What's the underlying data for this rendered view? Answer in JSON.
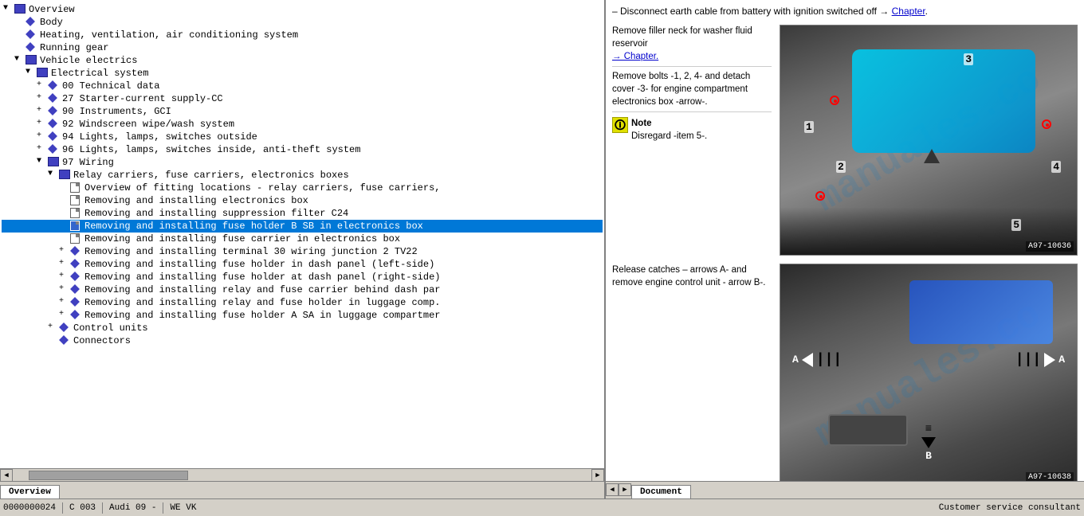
{
  "left_panel": {
    "tree_items": [
      {
        "id": 1,
        "indent": 0,
        "expand": "▼",
        "icon": "book",
        "label": "Overview",
        "selected": false
      },
      {
        "id": 2,
        "indent": 1,
        "expand": "",
        "icon": "diamond",
        "label": "Body",
        "selected": false
      },
      {
        "id": 3,
        "indent": 1,
        "expand": "",
        "icon": "diamond",
        "label": "Heating, ventilation, air conditioning system",
        "selected": false
      },
      {
        "id": 4,
        "indent": 1,
        "expand": "",
        "icon": "diamond",
        "label": "Running gear",
        "selected": false
      },
      {
        "id": 5,
        "indent": 1,
        "expand": "▼",
        "icon": "book",
        "label": "Vehicle electrics",
        "selected": false
      },
      {
        "id": 6,
        "indent": 2,
        "expand": "▼",
        "icon": "book",
        "label": "Electrical system",
        "selected": false
      },
      {
        "id": 7,
        "indent": 3,
        "expand": "+",
        "icon": "diamond",
        "label": "00 Technical data",
        "selected": false
      },
      {
        "id": 8,
        "indent": 3,
        "expand": "+",
        "icon": "diamond",
        "label": "27 Starter-current supply-CC",
        "selected": false
      },
      {
        "id": 9,
        "indent": 3,
        "expand": "+",
        "icon": "diamond",
        "label": "90 Instruments, GCI",
        "selected": false
      },
      {
        "id": 10,
        "indent": 3,
        "expand": "+",
        "icon": "diamond",
        "label": "92 Windscreen wipe/wash system",
        "selected": false
      },
      {
        "id": 11,
        "indent": 3,
        "expand": "+",
        "icon": "diamond",
        "label": "94 Lights, lamps, switches outside",
        "selected": false
      },
      {
        "id": 12,
        "indent": 3,
        "expand": "+",
        "icon": "diamond",
        "label": "96 Lights, lamps, switches inside, anti-theft system",
        "selected": false
      },
      {
        "id": 13,
        "indent": 3,
        "expand": "▼",
        "icon": "book",
        "label": "97 Wiring",
        "selected": false
      },
      {
        "id": 14,
        "indent": 4,
        "expand": "▼",
        "icon": "book",
        "label": "Relay carriers, fuse carriers, electronics boxes",
        "selected": false
      },
      {
        "id": 15,
        "indent": 5,
        "expand": "",
        "icon": "doc",
        "label": "Overview of fitting locations - relay carriers, fuse carriers,",
        "selected": false
      },
      {
        "id": 16,
        "indent": 5,
        "expand": "",
        "icon": "doc",
        "label": "Removing and installing electronics box",
        "selected": false
      },
      {
        "id": 17,
        "indent": 5,
        "expand": "",
        "icon": "doc",
        "label": "Removing and installing suppression filter C24",
        "selected": false
      },
      {
        "id": 18,
        "indent": 5,
        "expand": "",
        "icon": "doc",
        "label": "Removing and installing fuse holder B SB in electronics box",
        "selected": true
      },
      {
        "id": 19,
        "indent": 5,
        "expand": "",
        "icon": "doc",
        "label": "Removing and installing fuse carrier in electronics box",
        "selected": false
      },
      {
        "id": 20,
        "indent": 5,
        "expand": "+",
        "icon": "diamond",
        "label": "Removing and installing terminal 30 wiring junction 2 TV22",
        "selected": false
      },
      {
        "id": 21,
        "indent": 5,
        "expand": "+",
        "icon": "diamond",
        "label": "Removing and installing fuse holder in dash panel (left-side)",
        "selected": false
      },
      {
        "id": 22,
        "indent": 5,
        "expand": "+",
        "icon": "diamond",
        "label": "Removing and installing fuse holder at dash panel (right-side)",
        "selected": false
      },
      {
        "id": 23,
        "indent": 5,
        "expand": "+",
        "icon": "diamond",
        "label": "Removing and installing relay and fuse carrier behind dash par",
        "selected": false
      },
      {
        "id": 24,
        "indent": 5,
        "expand": "+",
        "icon": "diamond",
        "label": "Removing and installing relay and fuse holder in luggage comp.",
        "selected": false
      },
      {
        "id": 25,
        "indent": 5,
        "expand": "+",
        "icon": "diamond",
        "label": "Removing and installing fuse holder A SA in luggage compartmer",
        "selected": false
      },
      {
        "id": 26,
        "indent": 4,
        "expand": "+",
        "icon": "diamond",
        "label": "Control units",
        "selected": false
      },
      {
        "id": 27,
        "indent": 4,
        "expand": "",
        "icon": "diamond",
        "label": "Connectors",
        "selected": false
      }
    ],
    "tab_label": "Overview"
  },
  "right_panel": {
    "instruction_line": "– Disconnect earth cable from battery with ignition switched off → Chapter.",
    "instruction_link_text": "Chapter",
    "section1": {
      "text_col": {
        "line1": "Remove filler neck for washer fluid reservoir",
        "link": "→ Chapter.",
        "line2": "Remove bolts -1, 2, 4- and detach cover -3- for engine compartment electronics box -arrow-.",
        "note_label": "Note",
        "note_text": "Disregard -item 5-."
      },
      "img_label": "A97-10636",
      "markers": [
        "1",
        "2",
        "3",
        "4",
        "5"
      ]
    },
    "section2": {
      "text_col": {
        "line1": "Release catches – arrows A- and remove engine control unit - arrow B-."
      },
      "img_label": "A97-10638"
    },
    "tab_label": "Document"
  },
  "status_bar": {
    "left_text": "0000000024",
    "center_text": "C 003",
    "vehicle_text": "Audi 09 -",
    "right_text": "WE VK",
    "consultant_text": "Customer service consultant"
  }
}
